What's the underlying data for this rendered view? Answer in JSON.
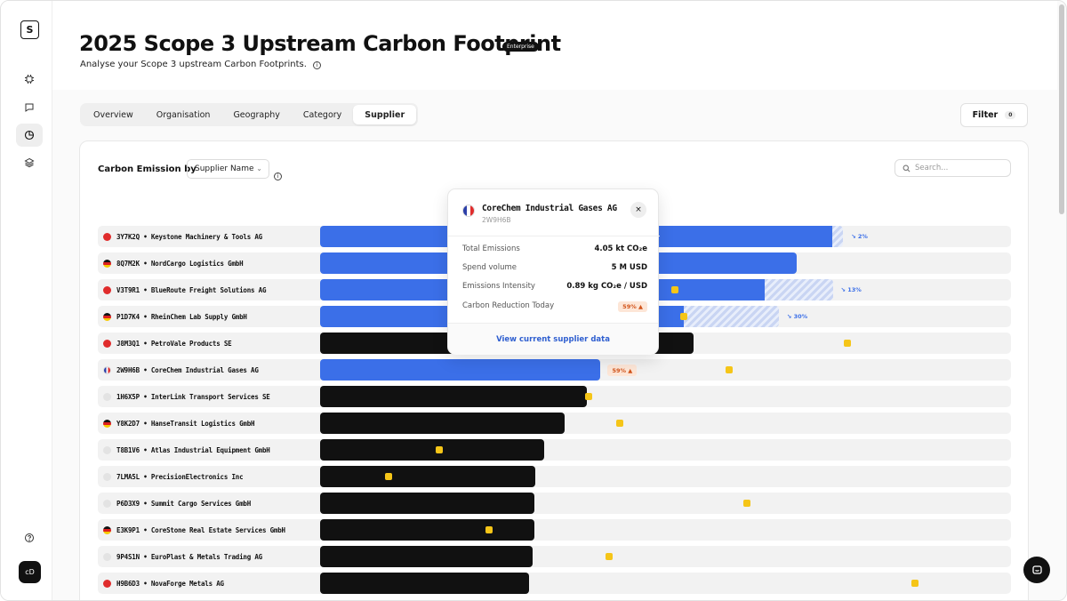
{
  "sidebar": {
    "logo": "S",
    "icons": [
      "cpu-icon",
      "chat-icon",
      "pie-chart-icon",
      "layers-icon"
    ],
    "help_icon": "help-icon",
    "avatar": "cD"
  },
  "header": {
    "title": "2025 Scope 3 Upstream Carbon Footprint",
    "badge": "Enterprise",
    "subtitle": "Analyse your Scope 3 upstream Carbon Footprints."
  },
  "tabs": [
    "Overview",
    "Organisation",
    "Geography",
    "Category",
    "Supplier"
  ],
  "active_tab": "Supplier",
  "filter": {
    "label": "Filter",
    "count": "0"
  },
  "card": {
    "label": "Carbon Emission by",
    "group_by": "Supplier Name",
    "search_placeholder": "Search..."
  },
  "colors": {
    "blue": "#3b6fe8",
    "black": "#111111",
    "marker": "#f5c518",
    "warning": "#d2541b"
  },
  "rows": [
    {
      "label": "3Y7K2Q • Keystone Machinery & Tools AG",
      "flag": "red",
      "style": "blue",
      "bar": 0.741,
      "hatch": 0.016,
      "trend": "↘ 2%"
    },
    {
      "label": "8Q7M2K • NordCargo Logistics GmbH",
      "flag": "de",
      "style": "blue",
      "bar": 0.69
    },
    {
      "label": "V3T9R1 • BlueRoute Freight Solutions AG",
      "flag": "red",
      "style": "blue",
      "bar": 0.643,
      "hatch": 0.099,
      "trend": "↘ 13%",
      "marker": 0.514
    },
    {
      "label": "P1D7K4 • RheinChem Lab Supply GmbH",
      "flag": "de",
      "style": "blue",
      "bar": 0.527,
      "hatch": 0.137,
      "trend": "↘ 30%",
      "marker": 0.526
    },
    {
      "label": "J8M3Q1 • PetroVale Products SE",
      "flag": "red",
      "style": "black",
      "bar": 0.54,
      "marker": 0.763
    },
    {
      "label": "2W9H6B • CoreChem Industrial Gases AG",
      "flag": "fr",
      "style": "blue",
      "bar": 0.406,
      "warn": "59%",
      "marker": 0.592
    },
    {
      "label": "1H6X5P • InterLink Transport Services SE",
      "flag": "none",
      "style": "black",
      "bar": 0.386,
      "marker": 0.389
    },
    {
      "label": "Y8K2D7 • HanseTransit Logistics GmbH",
      "flag": "de",
      "style": "black",
      "bar": 0.354,
      "marker": 0.434
    },
    {
      "label": "T8B1V6 • Atlas Industrial Equipment GmbH",
      "flag": "none",
      "style": "black",
      "bar": 0.324,
      "marker": 0.172
    },
    {
      "label": "7LMA5L • PrecisionElectronics Inc",
      "flag": "none",
      "style": "black",
      "bar": 0.311,
      "marker": 0.099
    },
    {
      "label": "P6D3X9 • Summit Cargo Services GmbH",
      "flag": "none",
      "style": "black",
      "bar": 0.31,
      "marker": 0.618
    },
    {
      "label": "E3K9P1 • CoreStone Real Estate Services GmbH",
      "flag": "de",
      "style": "black",
      "bar": 0.31,
      "marker": 0.244
    },
    {
      "label": "9P4S1N • EuroPlast & Metals Trading AG",
      "flag": "none",
      "style": "black",
      "bar": 0.307,
      "marker": 0.418
    },
    {
      "label": "H9B6D3 • NovaForge Metals AG",
      "flag": "red",
      "style": "black",
      "bar": 0.303,
      "marker": 0.861
    }
  ],
  "popup": {
    "name": "CoreChem Industrial Gases AG",
    "code": "2W9H6B",
    "total_label": "Total Emissions",
    "total_value": "4.05 kt CO₂e",
    "spend_label": "Spend volume",
    "spend_value": "5 M USD",
    "intensity_label": "Emissions Intensity",
    "intensity_value": "0.89 kg CO₂e / USD",
    "reduction_label": "Carbon Reduction Today",
    "reduction_value": "59%",
    "link": "View current supplier data",
    "close": "×"
  }
}
